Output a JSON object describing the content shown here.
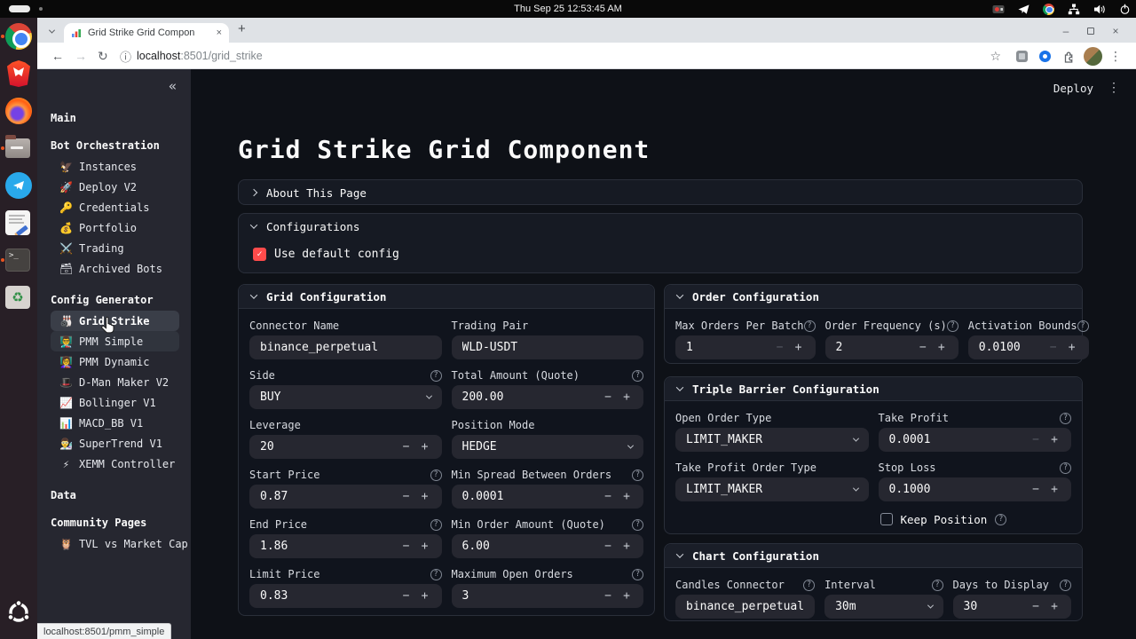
{
  "system": {
    "clock": "Thu Sep 25  12:53:45 AM"
  },
  "icons": {
    "collapse": "«",
    "kebab": "⋮",
    "minus": "−",
    "plus": "+",
    "check": "✓",
    "help": "?",
    "back": "←",
    "forward": "→",
    "reload": "↻",
    "info": "ⓘ",
    "star": "☆",
    "close": "×",
    "newtab": "+",
    "win_min": "–",
    "recycle": "♻",
    "terminal_prompt": ">_"
  },
  "dock": {
    "items": [
      "chrome",
      "brave",
      "firefox",
      "files",
      "telegram",
      "text-editor",
      "terminal",
      "trash",
      "ubuntu"
    ]
  },
  "browser": {
    "tab_title": "Grid Strike Grid Compon",
    "url_host": "localhost",
    "url_rest": ":8501/grid_strike",
    "status_tooltip": "localhost:8501/pmm_simple"
  },
  "header": {
    "deploy_label": "Deploy"
  },
  "sidebar": {
    "sections": [
      {
        "header": "Main"
      },
      {
        "header": "Bot Orchestration"
      },
      {
        "header": "Config Generator"
      },
      {
        "header": "Data"
      },
      {
        "header": "Community Pages"
      }
    ],
    "items": {
      "instances": {
        "icon": "🦅",
        "label": "Instances"
      },
      "deploy_v2": {
        "icon": "🚀",
        "label": "Deploy V2"
      },
      "credentials": {
        "icon": "🔑",
        "label": "Credentials"
      },
      "portfolio": {
        "icon": "💰",
        "label": "Portfolio"
      },
      "trading": {
        "icon": "⚔️",
        "label": "Trading"
      },
      "archived": {
        "icon": "🗃",
        "label": "Archived Bots"
      },
      "grid_strike": {
        "icon": "🎳",
        "label": "Grid Strike"
      },
      "pmm_simple": {
        "icon": "👨‍🏫",
        "label": "PMM Simple"
      },
      "pmm_dynamic": {
        "icon": "👩‍🏫",
        "label": "PMM Dynamic"
      },
      "dman_maker": {
        "icon": "🎩",
        "label": "D-Man Maker V2"
      },
      "bollinger": {
        "icon": "📈",
        "label": "Bollinger V1"
      },
      "macd_bb": {
        "icon": "📊",
        "label": "MACD_BB V1"
      },
      "supertrend": {
        "icon": "👨‍🔬",
        "label": "SuperTrend V1"
      },
      "xemm": {
        "icon": "⚡",
        "label": "XEMM Controller"
      },
      "tvl": {
        "icon": "🦉",
        "label": "TVL vs Market Cap"
      }
    }
  },
  "main": {
    "title": "Grid Strike Grid Component",
    "about": {
      "label": "About This Page"
    },
    "configurations": {
      "label": "Configurations",
      "use_default_label": "Use default config",
      "checked": true
    }
  },
  "grid_config": {
    "title": "Grid Configuration",
    "connector_name": {
      "label": "Connector Name",
      "value": "binance_perpetual"
    },
    "trading_pair": {
      "label": "Trading Pair",
      "value": "WLD-USDT"
    },
    "side": {
      "label": "Side",
      "value": "BUY"
    },
    "total_amount": {
      "label": "Total Amount (Quote)",
      "value": "200.00"
    },
    "leverage": {
      "label": "Leverage",
      "value": "20"
    },
    "position_mode": {
      "label": "Position Mode",
      "value": "HEDGE"
    },
    "start_price": {
      "label": "Start Price",
      "value": "0.87"
    },
    "min_spread": {
      "label": "Min Spread Between Orders",
      "value": "0.0001"
    },
    "end_price": {
      "label": "End Price",
      "value": "1.86"
    },
    "min_order_amount": {
      "label": "Min Order Amount (Quote)",
      "value": "6.00"
    },
    "limit_price": {
      "label": "Limit Price",
      "value": "0.83"
    },
    "max_open_orders": {
      "label": "Maximum Open Orders",
      "value": "3"
    }
  },
  "order_config": {
    "title": "Order Configuration",
    "max_orders_per_batch": {
      "label": "Max Orders Per Batch",
      "value": "1"
    },
    "order_frequency": {
      "label": "Order Frequency (s)",
      "value": "2"
    },
    "activation_bounds": {
      "label": "Activation Bounds",
      "value": "0.0100"
    }
  },
  "triple_barrier": {
    "title": "Triple Barrier Configuration",
    "open_order_type": {
      "label": "Open Order Type",
      "value": "LIMIT_MAKER"
    },
    "take_profit": {
      "label": "Take Profit",
      "value": "0.0001"
    },
    "take_profit_order_type": {
      "label": "Take Profit Order Type",
      "value": "LIMIT_MAKER"
    },
    "stop_loss": {
      "label": "Stop Loss",
      "value": "0.1000"
    },
    "keep_position": {
      "label": "Keep Position",
      "checked": false
    }
  },
  "chart_config": {
    "title": "Chart Configuration",
    "candles_connector": {
      "label": "Candles Connector",
      "value": "binance_perpetual"
    },
    "interval": {
      "label": "Interval",
      "value": "30m"
    },
    "days_to_display": {
      "label": "Days to Display",
      "value": "30"
    }
  },
  "colors": {
    "accent": "#ff4b4b",
    "app_bg": "#0e1117",
    "sidebar_bg": "#262730",
    "input_bg": "#262730",
    "panel_border": "#2a2f3a"
  }
}
